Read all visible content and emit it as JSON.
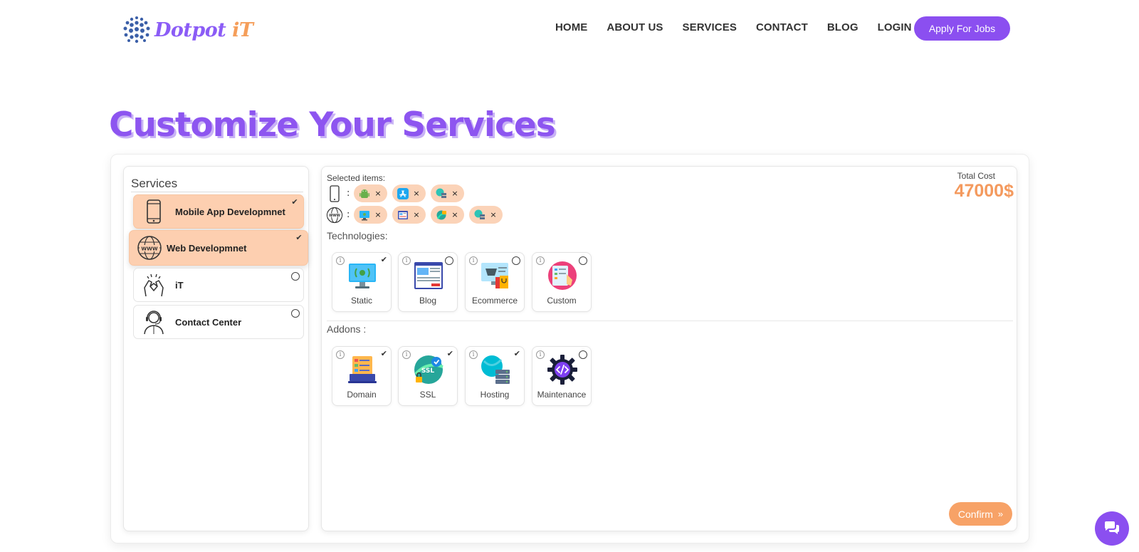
{
  "header": {
    "logo_part1": "Dotpot",
    "logo_part2": " iT",
    "nav": [
      "HOME",
      "ABOUT US",
      "SERVICES",
      "CONTACT",
      "BLOG",
      "LOGIN"
    ],
    "apply_label": "Apply For Jobs"
  },
  "page_title": "Customize Your Services",
  "services": {
    "heading": "Services",
    "items": [
      {
        "label": "Mobile App Developmnet",
        "icon": "smartphone-icon",
        "selected": true
      },
      {
        "label": "Web Developmnet",
        "icon": "www-globe-icon",
        "selected": true
      },
      {
        "label": "iT",
        "icon": "handshake-icon",
        "selected": false
      },
      {
        "label": "Contact Center",
        "icon": "call-agent-icon",
        "selected": false
      }
    ]
  },
  "selected": {
    "title": "Selected items:",
    "mobile_row": {
      "icon": "smartphone-icon",
      "colon": ":",
      "chips": [
        "android-icon",
        "app-store-icon",
        "hosting-icon"
      ]
    },
    "web_row": {
      "icon": "www-globe-icon",
      "colon": ":",
      "chips": [
        "static-site-icon",
        "blog-icon",
        "ssl-icon",
        "hosting-icon"
      ]
    },
    "remove_symbol": "×"
  },
  "total": {
    "label": "Total Cost",
    "value": "47000$"
  },
  "technologies": {
    "label": "Technologies:",
    "cards": [
      {
        "label": "Static",
        "icon": "static-monitor-icon",
        "checked": true
      },
      {
        "label": "Blog",
        "icon": "blog-page-icon",
        "checked": false
      },
      {
        "label": "Ecommerce",
        "icon": "ecommerce-icon",
        "checked": false
      },
      {
        "label": "Custom",
        "icon": "custom-design-icon",
        "checked": false
      }
    ]
  },
  "addons": {
    "label": "Addons :",
    "cards": [
      {
        "label": "Domain",
        "icon": "domain-laptop-icon",
        "checked": true
      },
      {
        "label": "SSL",
        "icon": "ssl-shield-icon",
        "checked": true
      },
      {
        "label": "Hosting",
        "icon": "hosting-server-icon",
        "checked": true
      },
      {
        "label": "Maintenance",
        "icon": "maintenance-gear-icon",
        "checked": false
      }
    ]
  },
  "card_info_symbol": "i",
  "check_symbol": "✔",
  "confirm": {
    "label": "Confirm",
    "arrows": "»"
  },
  "colors": {
    "purple": "#8b4ff0",
    "orange": "#f7a267",
    "chip_bg": "#fbd3b8",
    "selected_bg": "#fdcfb0"
  }
}
